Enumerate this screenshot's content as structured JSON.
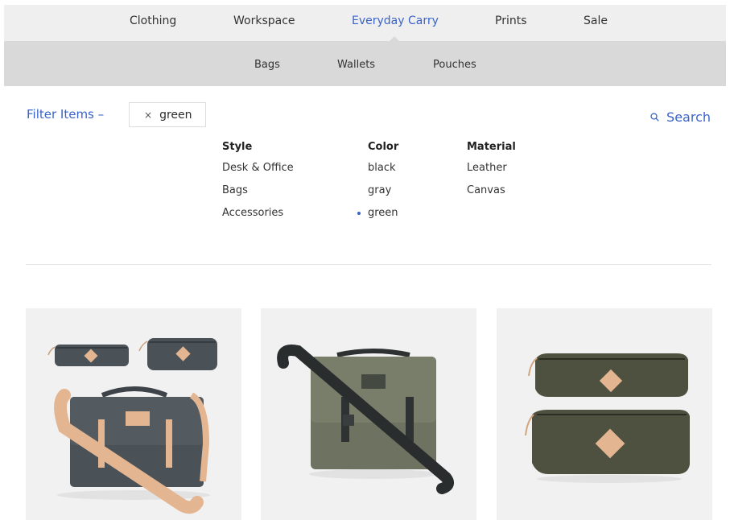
{
  "topnav": {
    "items": [
      "Clothing",
      "Workspace",
      "Everyday Carry",
      "Prints",
      "Sale"
    ],
    "active": "Everyday Carry"
  },
  "subnav": {
    "items": [
      "Bags",
      "Wallets",
      "Pouches"
    ]
  },
  "filter": {
    "label": "Filter Items –",
    "active_chip": "green",
    "remove_symbol": "×",
    "search_label": "Search"
  },
  "facets": [
    {
      "heading": "Style",
      "options": [
        "Desk & Office",
        "Bags",
        "Accessories"
      ]
    },
    {
      "heading": "Color",
      "options": [
        "black",
        "gray",
        "green"
      ],
      "selected": "green"
    },
    {
      "heading": "Material",
      "options": [
        "Leather",
        "Canvas"
      ]
    }
  ],
  "colors": {
    "accent": "#3a63c8",
    "topnav_bg": "#efefef",
    "subnav_bg": "#d9d9d9",
    "card_bg": "#f1f1f1",
    "charcoal_canvas": "#4a5157",
    "olive_canvas": "#6d7360",
    "dark_olive_canvas": "#4e5140",
    "leather_tan": "#e3b591"
  },
  "products": [
    {
      "icon": "charcoal-messenger-bag-with-pouches-image"
    },
    {
      "icon": "olive-messenger-bag-image"
    },
    {
      "icon": "olive-zip-pouches-image"
    }
  ]
}
